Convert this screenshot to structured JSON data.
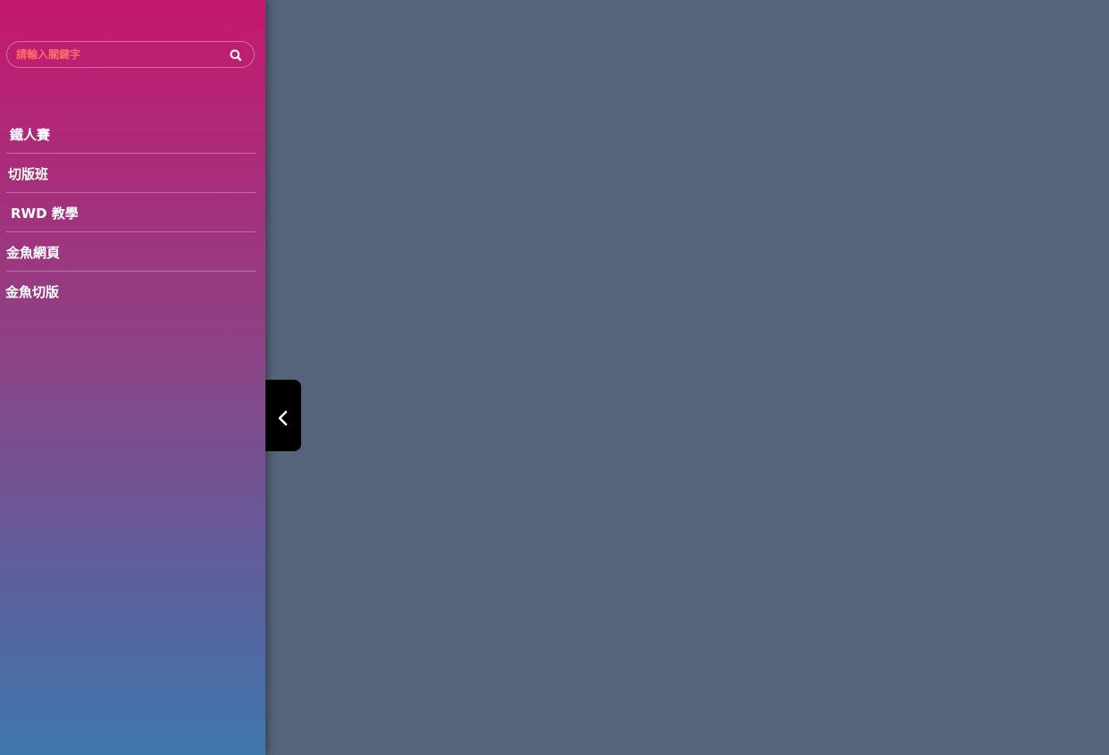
{
  "search": {
    "placeholder": "請輸入關鍵字",
    "icon": "search-icon"
  },
  "menu": {
    "items": [
      {
        "label": "鐵人賽"
      },
      {
        "label": "切版班"
      },
      {
        "label": "RWD 教學"
      },
      {
        "label": "金魚網頁"
      },
      {
        "label": "金魚切版"
      }
    ]
  },
  "toggle": {
    "icon": "chevron-left-icon"
  },
  "colors": {
    "sidebar_gradient_top": "#c5186e",
    "sidebar_gradient_bottom": "#3e76ac",
    "main_background": "#55647a",
    "placeholder_color": "#ff6b6b",
    "toggle_background": "#000000"
  }
}
